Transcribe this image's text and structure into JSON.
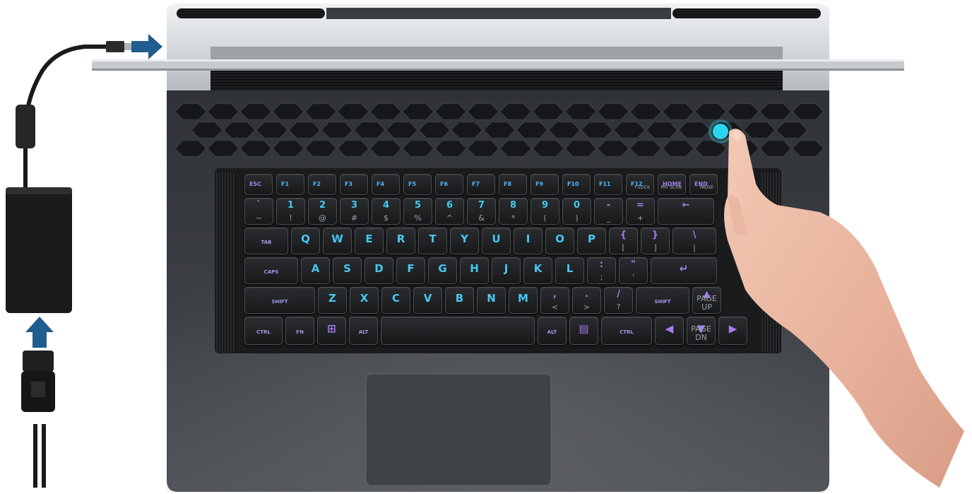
{
  "image": {
    "subject": "laptop-setup-illustration"
  },
  "colors": {
    "keyboard_backlight": "#46c8f0",
    "lid_light_left": "#b56cf0",
    "lid_light_right": "#3fd3f5",
    "power_button": "#29d7f0",
    "arrow": "#1f5d8f"
  },
  "keyboard": {
    "function_row": [
      {
        "label": "ESC",
        "sub": ""
      },
      {
        "label": "F1",
        "sub": ""
      },
      {
        "label": "F2",
        "sub": ""
      },
      {
        "label": "F3",
        "sub": ""
      },
      {
        "label": "F4",
        "sub": ""
      },
      {
        "label": "F5",
        "sub": ""
      },
      {
        "label": "F6",
        "sub": ""
      },
      {
        "label": "F7",
        "sub": ""
      },
      {
        "label": "F8",
        "sub": ""
      },
      {
        "label": "F9",
        "sub": ""
      },
      {
        "label": "F10",
        "sub": ""
      },
      {
        "label": "F11",
        "sub": ""
      },
      {
        "label": "F12",
        "sub": "F-LOCK"
      },
      {
        "label": "HOME",
        "sub": "PRT SCRN"
      },
      {
        "label": "END",
        "sub": "PAUSE"
      }
    ],
    "number_row": [
      {
        "main": "`",
        "sub": "~"
      },
      {
        "main": "1",
        "sub": "!"
      },
      {
        "main": "2",
        "sub": "@"
      },
      {
        "main": "3",
        "sub": "#"
      },
      {
        "main": "4",
        "sub": "$"
      },
      {
        "main": "5",
        "sub": "%"
      },
      {
        "main": "6",
        "sub": "^"
      },
      {
        "main": "7",
        "sub": "&"
      },
      {
        "main": "8",
        "sub": "*"
      },
      {
        "main": "9",
        "sub": "("
      },
      {
        "main": "0",
        "sub": ")"
      },
      {
        "main": "-",
        "sub": "_"
      },
      {
        "main": "=",
        "sub": "+"
      },
      {
        "main": "←",
        "sub": ""
      }
    ],
    "qwerty_row": [
      {
        "main": "TAB",
        "sub": ""
      },
      {
        "main": "Q",
        "sub": ""
      },
      {
        "main": "W",
        "sub": ""
      },
      {
        "main": "E",
        "sub": ""
      },
      {
        "main": "R",
        "sub": ""
      },
      {
        "main": "T",
        "sub": ""
      },
      {
        "main": "Y",
        "sub": ""
      },
      {
        "main": "U",
        "sub": ""
      },
      {
        "main": "I",
        "sub": ""
      },
      {
        "main": "O",
        "sub": ""
      },
      {
        "main": "P",
        "sub": ""
      },
      {
        "main": "{",
        "sub": "["
      },
      {
        "main": "}",
        "sub": "]"
      },
      {
        "main": "\\",
        "sub": "|"
      }
    ],
    "home_row": [
      {
        "main": "CAPS",
        "sub": ""
      },
      {
        "main": "A",
        "sub": ""
      },
      {
        "main": "S",
        "sub": ""
      },
      {
        "main": "D",
        "sub": ""
      },
      {
        "main": "F",
        "sub": ""
      },
      {
        "main": "G",
        "sub": ""
      },
      {
        "main": "H",
        "sub": ""
      },
      {
        "main": "J",
        "sub": ""
      },
      {
        "main": "K",
        "sub": ""
      },
      {
        "main": "L",
        "sub": ""
      },
      {
        "main": ":",
        "sub": ";"
      },
      {
        "main": "\"",
        "sub": "'"
      },
      {
        "main": "↵",
        "sub": ""
      }
    ],
    "shift_row": [
      {
        "main": "SHIFT",
        "sub": ""
      },
      {
        "main": "Z",
        "sub": ""
      },
      {
        "main": "X",
        "sub": ""
      },
      {
        "main": "C",
        "sub": ""
      },
      {
        "main": "V",
        "sub": ""
      },
      {
        "main": "B",
        "sub": ""
      },
      {
        "main": "N",
        "sub": ""
      },
      {
        "main": "M",
        "sub": ""
      },
      {
        "main": ",",
        "sub": "<"
      },
      {
        "main": ".",
        "sub": ">"
      },
      {
        "main": "/",
        "sub": "?"
      },
      {
        "main": "SHIFT",
        "sub": ""
      },
      {
        "main": "▲",
        "sub": "PAGE UP"
      }
    ],
    "bottom_row": [
      {
        "main": "CTRL",
        "sub": ""
      },
      {
        "main": "FN",
        "sub": ""
      },
      {
        "main": "⊞",
        "sub": ""
      },
      {
        "main": "ALT",
        "sub": ""
      },
      {
        "main": "",
        "sub": ""
      },
      {
        "main": "ALT",
        "sub": ""
      },
      {
        "main": "▤",
        "sub": ""
      },
      {
        "main": "CTRL",
        "sub": ""
      },
      {
        "main": "◀",
        "sub": ""
      },
      {
        "main": "▼",
        "sub": "PAGE DN"
      },
      {
        "main": "▶",
        "sub": ""
      }
    ]
  }
}
